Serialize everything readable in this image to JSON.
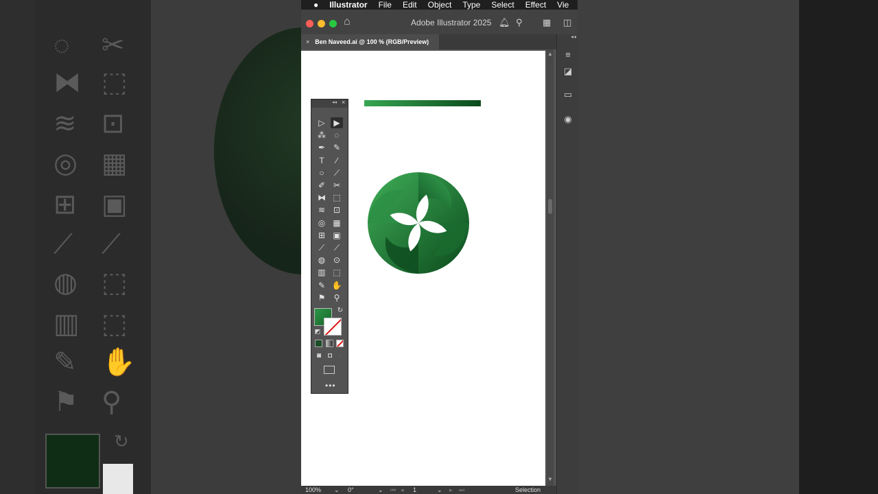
{
  "menubar": {
    "app_name": "Illustrator",
    "items": [
      "File",
      "Edit",
      "Object",
      "Type",
      "Select",
      "Effect",
      "Vie"
    ]
  },
  "titlebar": {
    "app_title": "Adobe Illustrator 2025",
    "traffic_lights": {
      "close": "#ff5f57",
      "minimize": "#febc2e",
      "zoom": "#28c840"
    }
  },
  "document_tab": {
    "title": "Ben Naveed.ai @ 100 % (RGB/Preview)",
    "close_glyph": "×"
  },
  "statusbar": {
    "zoom": "100%",
    "rotation": "0°",
    "artboard_number": "1",
    "tool_name": "Selection"
  },
  "colors": {
    "fill_swatch": "#2e9447",
    "gradient_start": "#37a651",
    "gradient_end": "#0b4a1c"
  },
  "tools_panel": {
    "more_glyph": "•••",
    "tools": [
      "selection-tool",
      "direct-selection-tool",
      "magic-wand-tool",
      "lasso-tool",
      "pen-tool",
      "curvature-tool",
      "type-tool",
      "line-segment-tool",
      "ellipse-tool",
      "paintbrush-tool",
      "shaper-tool",
      "scissors-tool",
      "reflect-tool",
      "scale-tool",
      "warp-tool",
      "free-transform-tool",
      "shape-builder-tool",
      "perspective-grid-tool",
      "mesh-tool",
      "gradient-tool",
      "eyedropper-tool",
      "measure-tool",
      "blend-tool",
      "symbol-sprayer-tool",
      "column-graph-tool",
      "artboard-tool",
      "slice-tool",
      "hand-tool",
      "puppet-warp-tool",
      "zoom-tool"
    ]
  },
  "right_dock": {
    "panels": [
      "properties-panel-icon",
      "transparency-panel-icon",
      "gradient-panel-icon",
      "appearance-panel-icon"
    ]
  }
}
